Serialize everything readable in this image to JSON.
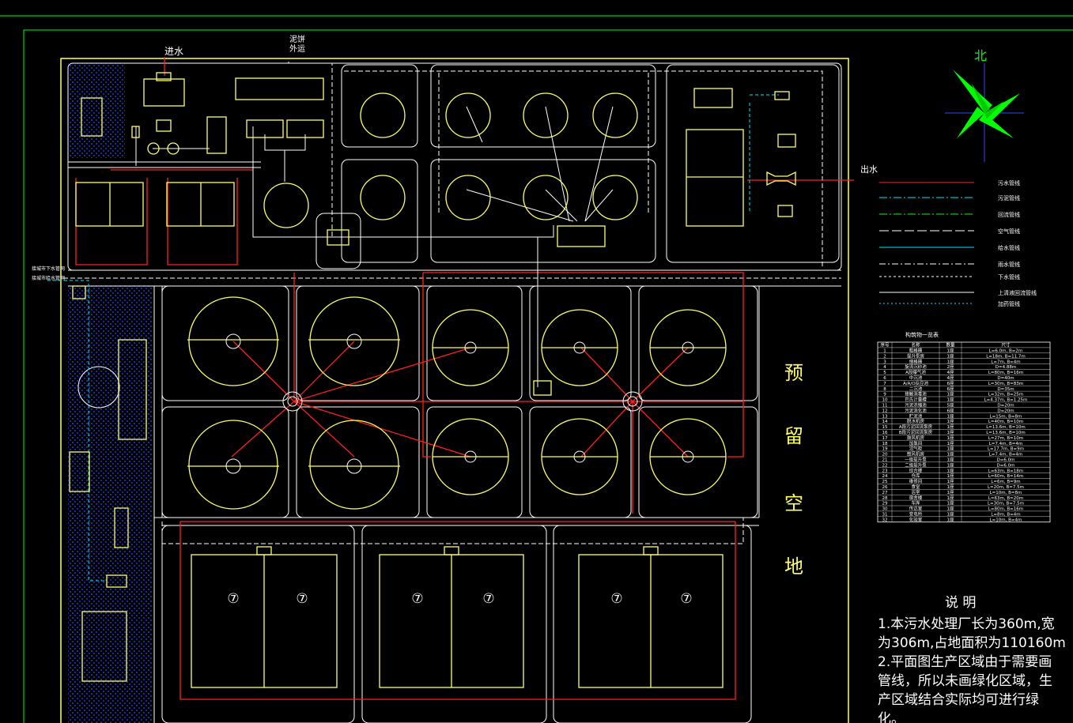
{
  "drawing": {
    "inlet_label": "进水",
    "sludge_label_1": "泥饼",
    "sludge_label_2": "外运",
    "outlet_label": "出水",
    "north_label": "北",
    "reserve_chars": [
      "预",
      "留",
      "空",
      "地"
    ],
    "tank_7_label": "⑦",
    "left_note_1": "接城市下水管网",
    "left_note_2": "接城市给水管网"
  },
  "legend": {
    "items": [
      "污水管线",
      "污泥管线",
      "回流管线",
      "空气管线",
      "给水管线",
      "雨水管线",
      "下水管线",
      "上清液回流管线",
      "加药管线"
    ]
  },
  "table": {
    "title": "构筑物一览表",
    "headers": [
      "序号",
      "名称",
      "数量",
      "尺寸"
    ],
    "rows": [
      [
        "1",
        "粗格栅",
        "1座",
        "L=6.0m, B=2m"
      ],
      [
        "2",
        "提升泵房",
        "1座",
        "L=18m, B=11.7m"
      ],
      [
        "3",
        "细格栅",
        "1座",
        "L=7m, B=4m"
      ],
      [
        "4",
        "旋流沉砂池",
        "2座",
        "D=4.88m"
      ],
      [
        "5",
        "A段曝气池",
        "4座",
        "L=80m, B=16m"
      ],
      [
        "6",
        "中沉池",
        "4座",
        "D=40m"
      ],
      [
        "7",
        "A/A/O反应池",
        "6座",
        "L=30m, B=83m"
      ],
      [
        "8",
        "二沉池",
        "6座",
        "D=35m"
      ],
      [
        "9",
        "接触消毒池",
        "1座",
        "L=32m, B=25m"
      ],
      [
        "10",
        "巴氏计量槽",
        "1座",
        "L=4.37m, B=1.25m"
      ],
      [
        "11",
        "污泥浓缩池",
        "5座",
        "D=20m"
      ],
      [
        "12",
        "污泥消化池",
        "6座",
        "D=20m"
      ],
      [
        "13",
        "贮泥池",
        "1座",
        "L=15m, B=8m"
      ],
      [
        "14",
        "脱水机房",
        "1座",
        "L=40m, B=10m"
      ],
      [
        "15",
        "A段污泥回流泵房",
        "1座",
        "L=13.6m, B=10m"
      ],
      [
        "16",
        "B段污泥回流泵房",
        "1座",
        "L=13.6m, B=10m"
      ],
      [
        "17",
        "鼓风机房",
        "1座",
        "L=27m, B=10m"
      ],
      [
        "18",
        "加氯间",
        "1座",
        "L=7.4m, B=4m"
      ],
      [
        "19",
        "沼气柜",
        "1座",
        "L=17.7m, B=9m"
      ],
      [
        "20",
        "鼓风机房",
        "1座",
        "L=7.4m, B=4m"
      ],
      [
        "21",
        "一级提升泵",
        "1座",
        "D=6.0m"
      ],
      [
        "22",
        "二级提升泵",
        "1座",
        "D=6.0m"
      ],
      [
        "23",
        "综合楼",
        "1座",
        "L=63m, B=18m"
      ],
      [
        "24",
        "仓库",
        "1座",
        "L=60m, B=14m"
      ],
      [
        "25",
        "维修间",
        "1座",
        "L=6m, B=9m"
      ],
      [
        "26",
        "食堂",
        "1座",
        "L=20m, B=7.5m"
      ],
      [
        "27",
        "浴室",
        "1座",
        "L=10m, B=8m"
      ],
      [
        "28",
        "宿舍楼",
        "1座",
        "L=63m, B=20m"
      ],
      [
        "29",
        "车库",
        "1座",
        "L=30m, B=7.5m"
      ],
      [
        "30",
        "传达室",
        "1座",
        "L=80m, B=16m"
      ],
      [
        "31",
        "变电所",
        "1座",
        "L=8m, B=4m"
      ],
      [
        "32",
        "化验室",
        "1座",
        "L=10m, B=4m"
      ]
    ]
  },
  "notes": {
    "title": "说  明",
    "lines": [
      "1.本污水处理厂长为360m,宽",
      "为306m,占地面积为110160m",
      "2.平面图生产区域由于需要画",
      "管线，所以未画绿化区域，生",
      "产区域结合实际均可进行绿",
      "化。"
    ]
  },
  "colors": {
    "background": "#000000",
    "frame": "#00ff00",
    "structure": "#ffff66",
    "sewage_pipe": "#ff2020",
    "road": "#ffffff",
    "water": "#00e5ff",
    "compass": "#00ff00"
  }
}
